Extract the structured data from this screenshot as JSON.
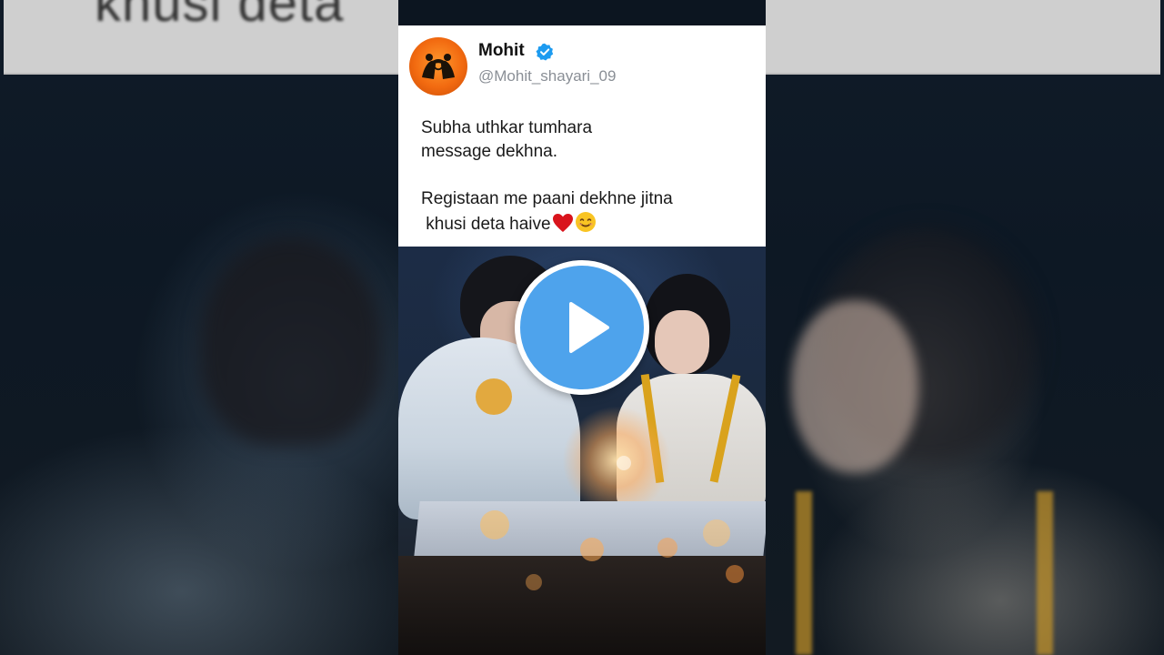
{
  "background": {
    "blurred_top_text": "khusi deta"
  },
  "tweet": {
    "name": "Mohit",
    "handle": "@Mohit_shayari_09",
    "lines": [
      "Subha uthkar tumhara",
      "message dekhna.",
      "Registaan me paani dekhne jitna",
      " khusi deta haive"
    ],
    "emojis": [
      "red-heart",
      "smiling-face"
    ],
    "verified": true
  },
  "player": {
    "play_icon": "play-icon",
    "accent_color": "#4ea3ec"
  },
  "colors": {
    "card_bg": "#ffffff",
    "handle_color": "#8a8f96",
    "avatar_orange": "#f26a10",
    "verified_blue": "#1d9bf0"
  }
}
